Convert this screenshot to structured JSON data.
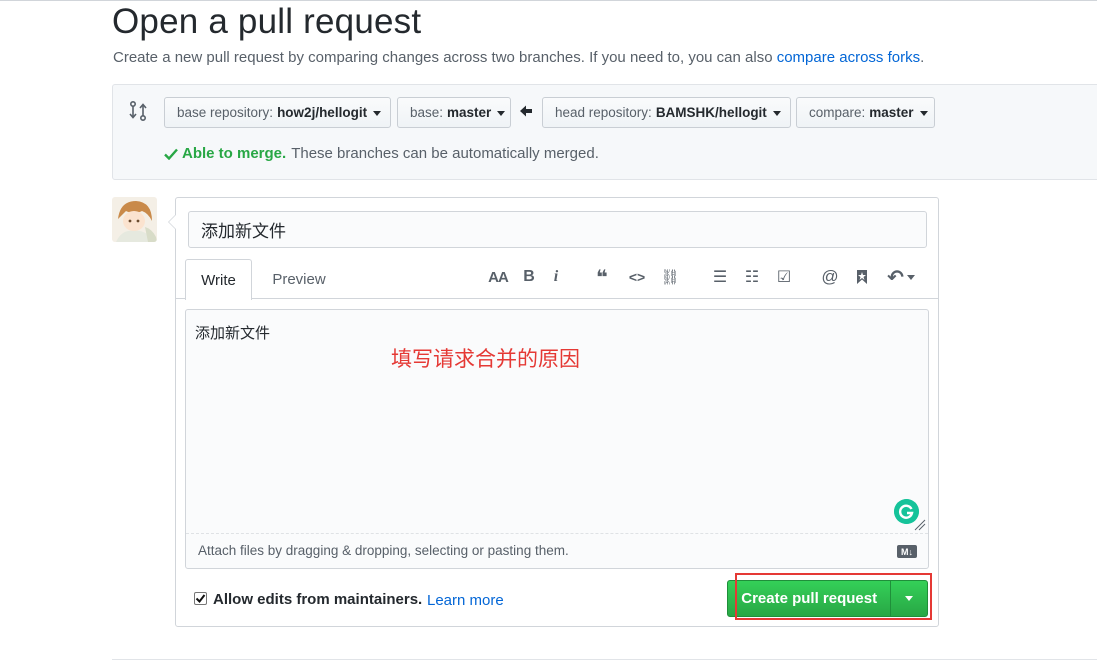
{
  "header": {
    "title": "Open a pull request",
    "subtitle_text": "Create a new pull request by comparing changes across two branches. If you need to, you can also ",
    "subtitle_link": "compare across forks",
    "subtitle_end": "."
  },
  "range": {
    "base_repo_label": "base repository:",
    "base_repo_value": "how2j/hellogit",
    "base_label": "base:",
    "base_value": "master",
    "head_repo_label": "head repository:",
    "head_repo_value": "BAMSHK/hellogit",
    "compare_label": "compare:",
    "compare_value": "master",
    "merge_ok": "Able to merge.",
    "merge_msg": "These branches can be automatically merged."
  },
  "form": {
    "title_value": "添加新文件",
    "tab_write": "Write",
    "tab_preview": "Preview",
    "toolbar": {
      "heading": "AA",
      "bold": "B",
      "italic": "i",
      "quote": "❝",
      "code": "<>",
      "link": "⛓",
      "ul": "☰",
      "ol": "☷",
      "task": "☑",
      "mention": "@",
      "saved": "🔖",
      "reply": "↶"
    },
    "body_value": "添加新文件",
    "annotation": "填写请求合并的原因",
    "attach_text": "Attach files by dragging & dropping, selecting or pasting them.",
    "md_badge": "M↓",
    "allow_edits": "Allow edits from maintainers.",
    "learn_more": "Learn more",
    "submit_label": "Create pull request"
  },
  "colors": {
    "link": "#0366d6",
    "success": "#28a745",
    "annotation": "#e53935"
  }
}
